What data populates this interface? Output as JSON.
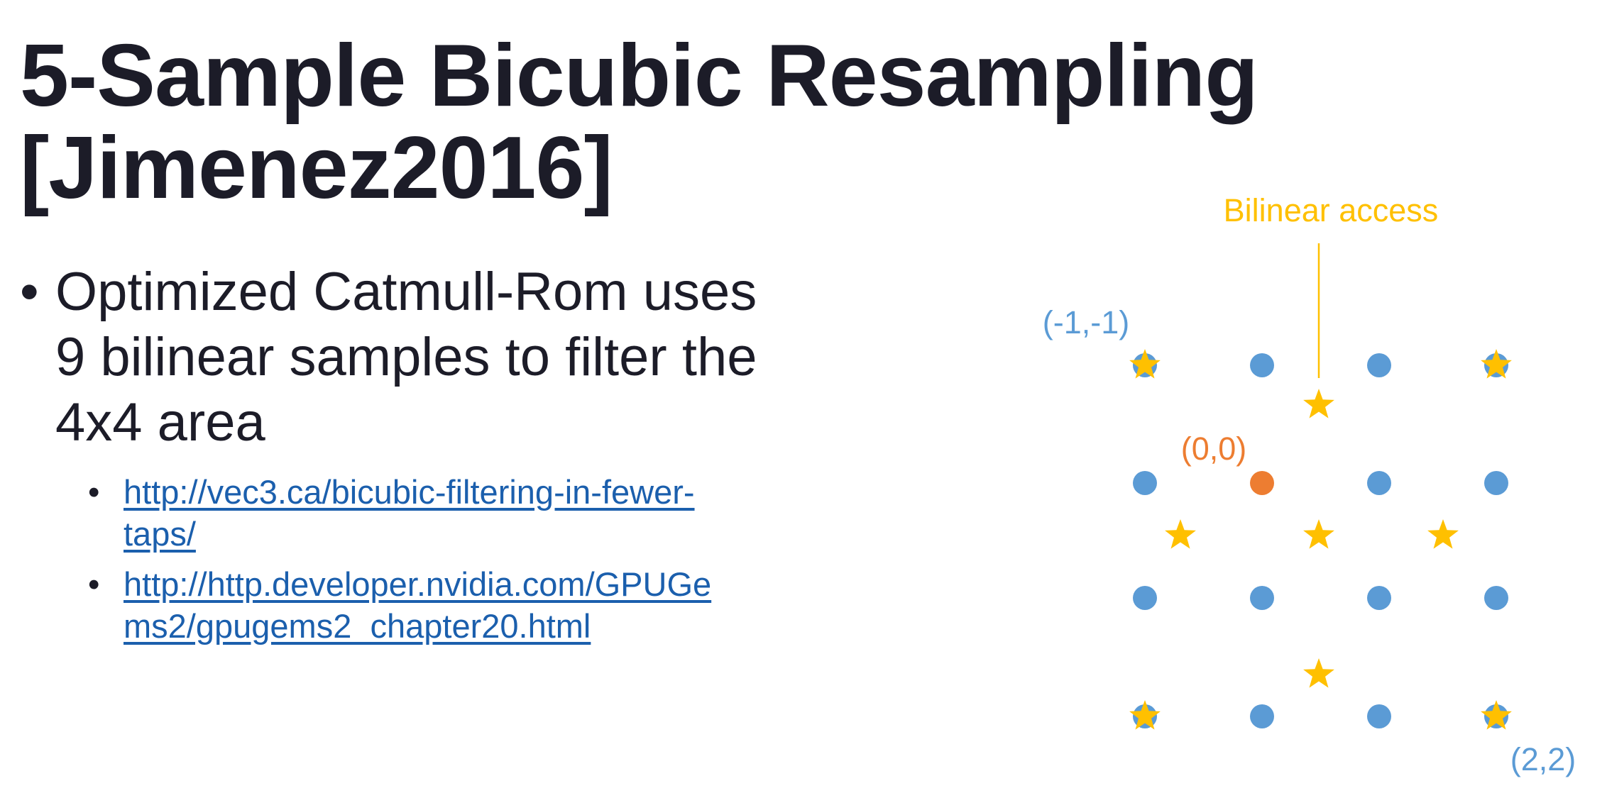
{
  "slide": {
    "title_line1": "5-Sample Bicubic Resampling",
    "title_line2": "[Jimenez2016]",
    "bullet": {
      "lines": [
        "Optimized Catmull-Rom uses",
        "9 bilinear samples to filter the",
        "4x4 area"
      ]
    },
    "links": [
      {
        "lines": [
          "http://vec3.ca/bicubic-filtering-in-fewer-",
          "taps/"
        ]
      },
      {
        "lines": [
          "http://http.developer.nvidia.com/GPUGe",
          "ms2/gpugems2_chapter20.html"
        ]
      }
    ]
  },
  "diagram": {
    "labels": {
      "bilinear_access": "Bilinear access",
      "top_left": "(-1,-1)",
      "origin": "(0,0)",
      "bottom_right": "(2,2)"
    },
    "grid_size": 4,
    "origin_cell": [
      1,
      1
    ],
    "colors": {
      "texel": "#5b9bd5",
      "origin": "#ed7d31",
      "star": "#ffc000",
      "label_blue": "#5b9bd5",
      "label_orange": "#ed7d31",
      "label_yellow": "#ffc000"
    }
  }
}
